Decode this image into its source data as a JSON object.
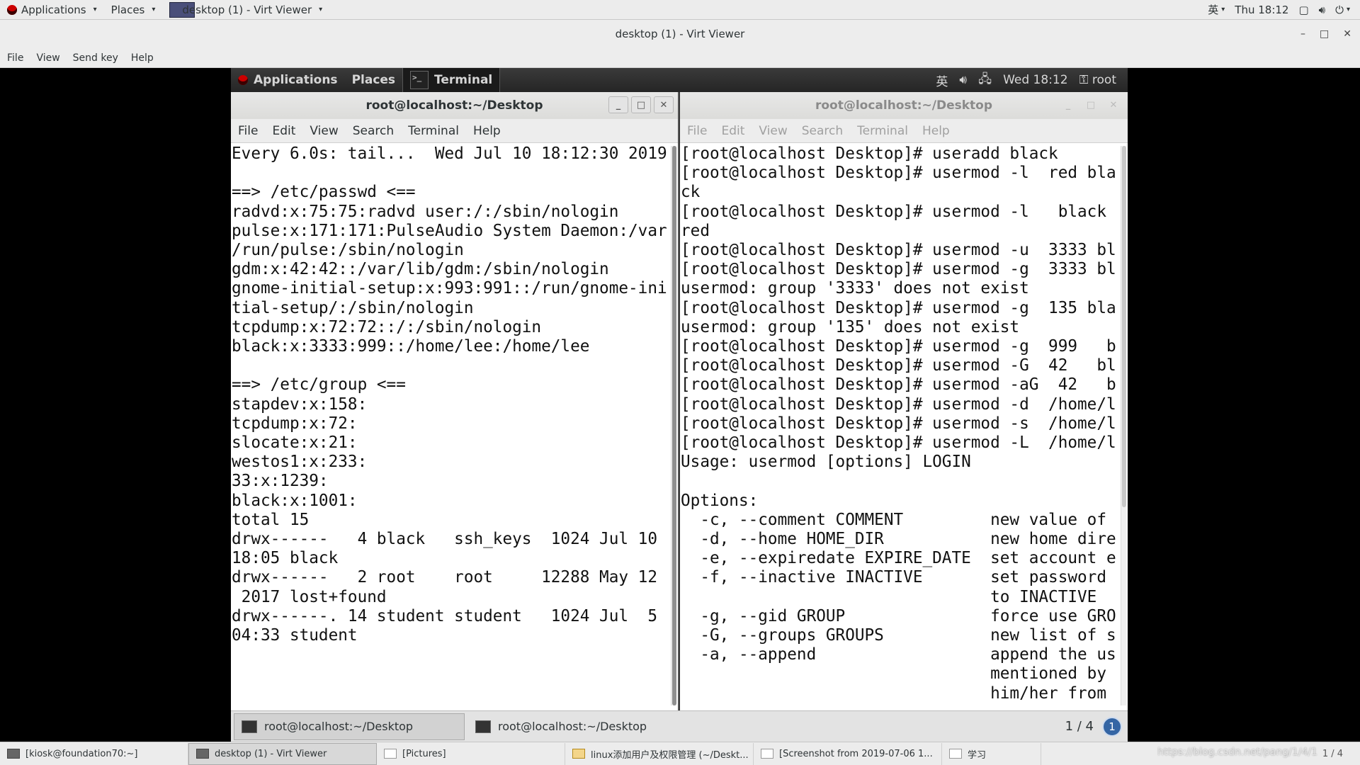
{
  "host_panel": {
    "applications": "Applications",
    "places": "Places",
    "window_title": "desktop (1) - Virt Viewer",
    "input_method": "英",
    "clock": "Thu 18:12"
  },
  "viewer": {
    "title": "desktop (1) - Virt Viewer",
    "menu": [
      "File",
      "View",
      "Send key",
      "Help"
    ]
  },
  "guest_panel": {
    "applications": "Applications",
    "places": "Places",
    "terminal": "Terminal",
    "input_method": "英",
    "clock": "Wed 18:12",
    "user": "root"
  },
  "left_terminal": {
    "title": "root@localhost:~/Desktop",
    "menu": [
      "File",
      "Edit",
      "View",
      "Search",
      "Terminal",
      "Help"
    ],
    "content": "Every 6.0s: tail...  Wed Jul 10 18:12:30 2019\n\n==> /etc/passwd <==\nradvd:x:75:75:radvd user:/:/sbin/nologin\npulse:x:171:171:PulseAudio System Daemon:/var\n/run/pulse:/sbin/nologin\ngdm:x:42:42::/var/lib/gdm:/sbin/nologin\ngnome-initial-setup:x:993:991::/run/gnome-ini\ntial-setup/:/sbin/nologin\ntcpdump:x:72:72::/:/sbin/nologin\nblack:x:3333:999::/home/lee:/home/lee\n\n==> /etc/group <==\nstapdev:x:158:\ntcpdump:x:72:\nslocate:x:21:\nwestos1:x:233:\n33:x:1239:\nblack:x:1001:\ntotal 15\ndrwx------   4 black   ssh_keys  1024 Jul 10\n18:05 black\ndrwx------   2 root    root     12288 May 12\n 2017 lost+found\ndrwx------. 14 student student   1024 Jul  5\n04:33 student"
  },
  "right_terminal": {
    "title": "root@localhost:~/Desktop",
    "menu": [
      "File",
      "Edit",
      "View",
      "Search",
      "Terminal",
      "Help"
    ],
    "content": "[root@localhost Desktop]# useradd black\n[root@localhost Desktop]# usermod -l  red bla\nck\n[root@localhost Desktop]# usermod -l   black\nred\n[root@localhost Desktop]# usermod -u  3333 bl\n[root@localhost Desktop]# usermod -g  3333 bl\nusermod: group '3333' does not exist\n[root@localhost Desktop]# usermod -g  135 bla\nusermod: group '135' does not exist\n[root@localhost Desktop]# usermod -g  999   b\n[root@localhost Desktop]# usermod -G  42   bl\n[root@localhost Desktop]# usermod -aG  42   b\n[root@localhost Desktop]# usermod -d  /home/l\n[root@localhost Desktop]# usermod -s  /home/l\n[root@localhost Desktop]# usermod -L  /home/l\nUsage: usermod [options] LOGIN\n\nOptions:\n  -c, --comment COMMENT         new value of\n  -d, --home HOME_DIR           new home dire\n  -e, --expiredate EXPIRE_DATE  set account e\n  -f, --inactive INACTIVE       set password\n                                to INACTIVE\n  -g, --gid GROUP               force use GRO\n  -G, --groups GROUPS           new list of s\n  -a, --append                  append the us\n                                mentioned by\n                                him/her from"
  },
  "guest_taskbar": {
    "tasks": [
      "root@localhost:~/Desktop",
      "root@localhost:~/Desktop"
    ],
    "pager": "1 / 4",
    "badge": "1"
  },
  "host_taskbar": {
    "tasks": [
      "[kiosk@foundation70:~]",
      "desktop (1) - Virt Viewer",
      "[Pictures]",
      "linux添加用户及权限管理 (~/Deskt...",
      "[Screenshot from 2019-07-06 1...",
      "学习"
    ],
    "pager": "1 / 4",
    "watermark": "https://blog.csdn.net/pang/1/4/1"
  }
}
